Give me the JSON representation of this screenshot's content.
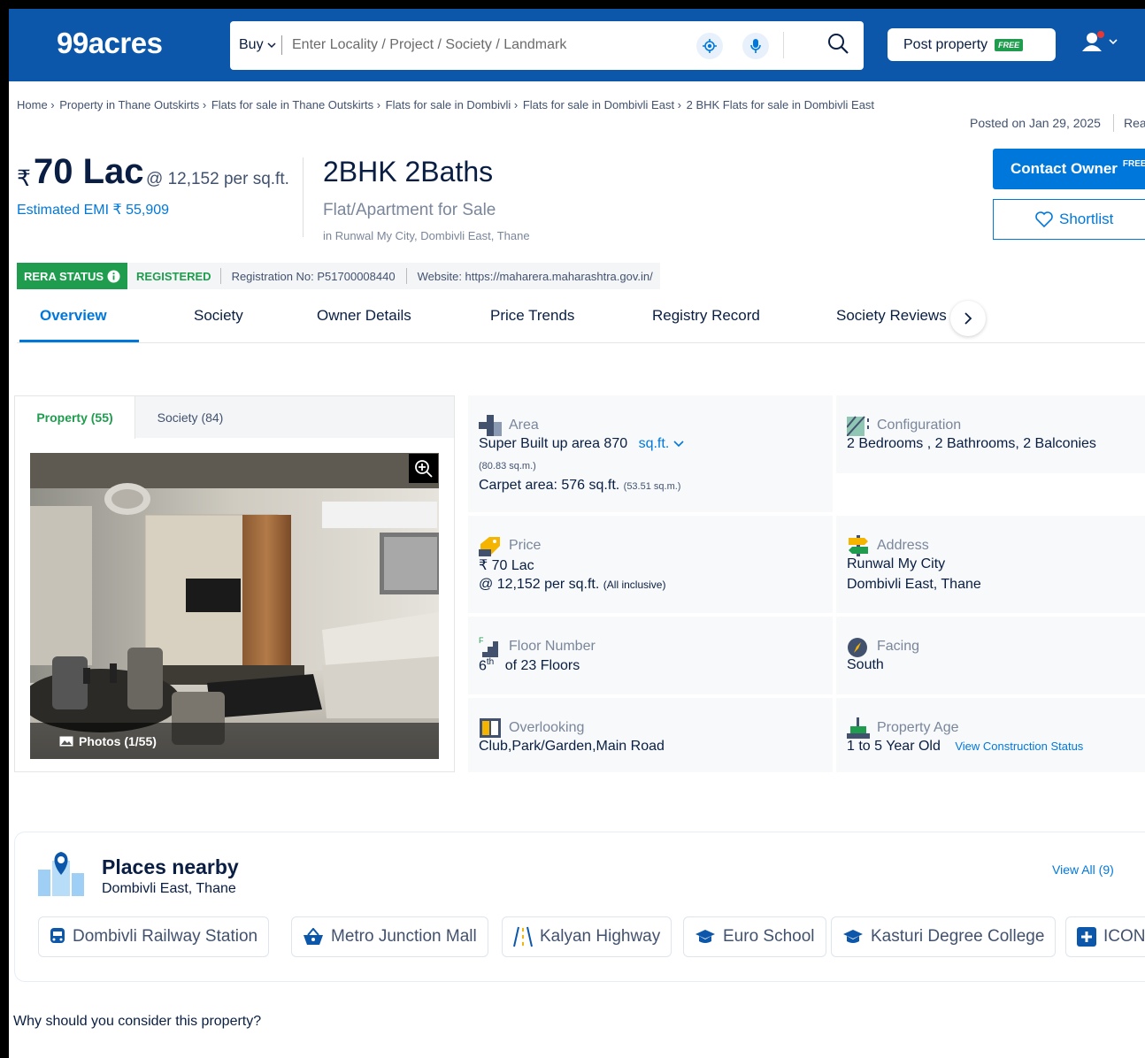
{
  "header": {
    "logo": "99acres",
    "buy_label": "Buy",
    "search_placeholder": "Enter Locality / Project / Society / Landmark",
    "post_property": "Post property",
    "free_badge": "FREE",
    "brand_color": "#0c57a9"
  },
  "breadcrumbs": [
    "Home ›",
    "Property in Thane Outskirts ›",
    "Flats for sale in Thane Outskirts ›",
    "Flats for sale in Dombivli ›",
    "Flats for sale in Dombivli East ›",
    "2 BHK Flats for sale in Dombivli East"
  ],
  "posted": "Posted on Jan 29, 2025",
  "posted_extra": "Rea",
  "listing": {
    "rupee": "₹",
    "price": "70 Lac",
    "per_sqft": "@ 12,152 per sq.ft.",
    "emi": "Estimated EMI ₹ 55,909",
    "title": "2BHK 2Baths",
    "type": "Flat/Apartment for Sale",
    "location": "in Runwal My City, Dombivli East, Thane"
  },
  "actions": {
    "contact": "Contact Owner",
    "contact_badge": "FREE",
    "shortlist": "Shortlist"
  },
  "rera": {
    "status": "RERA STATUS",
    "registered": "REGISTERED",
    "reg_no": "Registration No: P51700008440",
    "website": "Website: https://maharera.maharashtra.gov.in/"
  },
  "tabs": [
    "Overview",
    "Society",
    "Owner Details",
    "Price Trends",
    "Registry Record",
    "Society Reviews"
  ],
  "gallery": {
    "tab_property": "Property (55)",
    "tab_society": "Society (84)",
    "caption": "Photos (1/55)"
  },
  "details": {
    "area": {
      "label": "Area",
      "super": "Super Built up area 870",
      "unit": "sq.ft.",
      "super_sqm": "(80.83 sq.m.)",
      "carpet": "Carpet area: 576 sq.ft.",
      "carpet_sqm": "(53.51 sq.m.)"
    },
    "configuration": {
      "label": "Configuration",
      "value": "2 Bedrooms , 2 Bathrooms, 2 Balconies"
    },
    "price": {
      "label": "Price",
      "value": "₹ 70 Lac",
      "per_sqft": "@ 12,152 per sq.ft.",
      "inclusive": "(All inclusive)"
    },
    "address": {
      "label": "Address",
      "line1": "Runwal My City",
      "line2": "Dombivli East, Thane"
    },
    "floor": {
      "label": "Floor Number",
      "floor": "6",
      "suffix": "th",
      "of": "of 23 Floors"
    },
    "facing": {
      "label": "Facing",
      "value": "South"
    },
    "overlooking": {
      "label": "Overlooking",
      "value": "Club,Park/Garden,Main Road"
    },
    "age": {
      "label": "Property Age",
      "value": "1 to 5 Year Old",
      "link": "View Construction Status"
    }
  },
  "places": {
    "title": "Places nearby",
    "subtitle": "Dombivli East, Thane",
    "view_all": "View All (9)",
    "chips": [
      "Dombivli Railway Station",
      "Metro Junction Mall",
      "Kalyan Highway",
      "Euro School",
      "Kasturi Degree College",
      "ICON"
    ]
  },
  "why": "Why should you consider this property?"
}
